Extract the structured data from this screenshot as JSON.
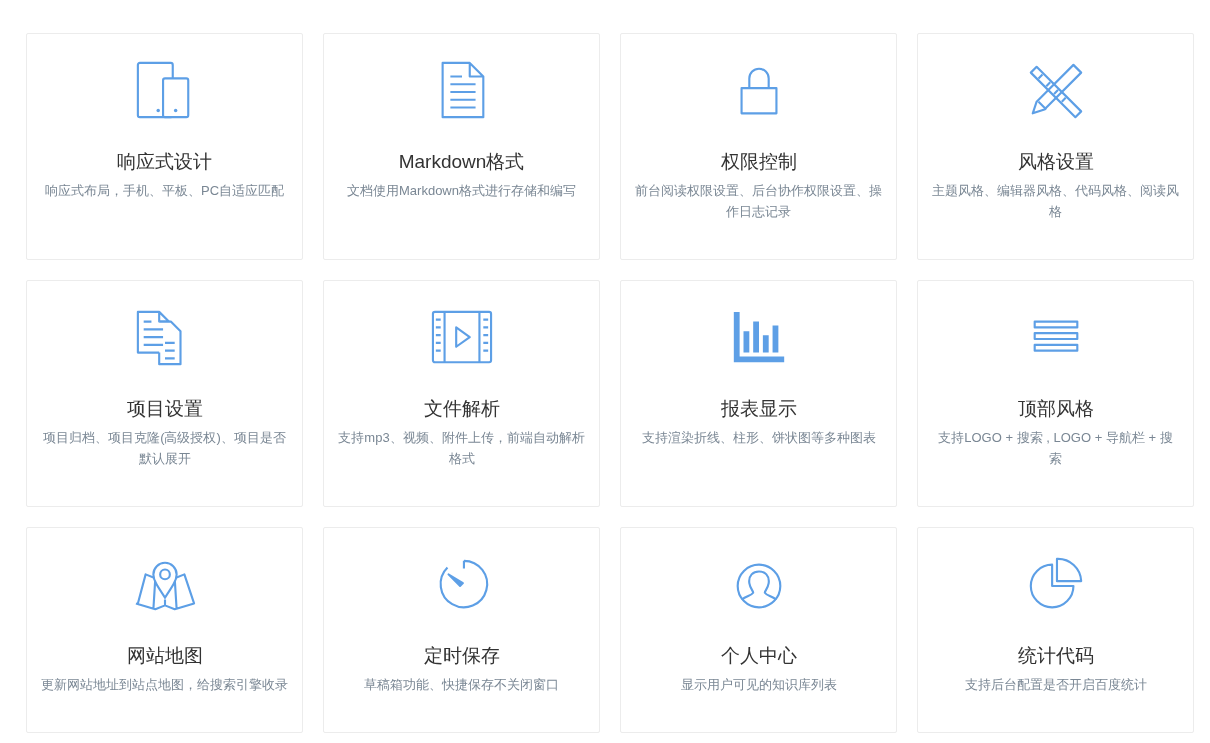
{
  "features": [
    {
      "kind": "devices",
      "title": "响应式设计",
      "description": "响应式布局，手机、平板、PC自适应匹配"
    },
    {
      "kind": "document",
      "title": "Markdown格式",
      "description": "文档使用Markdown格式进行存储和编写"
    },
    {
      "kind": "lock",
      "title": "权限控制",
      "description": "前台阅读权限设置、后台协作权限设置、操作日志记录"
    },
    {
      "kind": "tools",
      "title": "风格设置",
      "description": "主题风格、编辑器风格、代码风格、阅读风格"
    },
    {
      "kind": "documents",
      "title": "项目设置",
      "description": "项目归档、项目克隆(高级授权)、项目是否默认展开"
    },
    {
      "kind": "video",
      "title": "文件解析",
      "description": "支持mp3、视频、附件上传，前端自动解析格式"
    },
    {
      "kind": "chart",
      "title": "报表显示",
      "description": "支持渲染折线、柱形、饼状图等多种图表"
    },
    {
      "kind": "bars",
      "title": "顶部风格",
      "description": "支持LOGO + 搜索 , LOGO + 导航栏 + 搜索"
    },
    {
      "kind": "map",
      "title": "网站地图",
      "description": "更新网站地址到站点地图，给搜索引擎收录"
    },
    {
      "kind": "timer",
      "title": "定时保存",
      "description": "草稿箱功能、快捷保存不关闭窗口"
    },
    {
      "kind": "user",
      "title": "个人中心",
      "description": "显示用户可见的知识库列表"
    },
    {
      "kind": "pie",
      "title": "统计代码",
      "description": "支持后台配置是否开启百度统计"
    }
  ]
}
